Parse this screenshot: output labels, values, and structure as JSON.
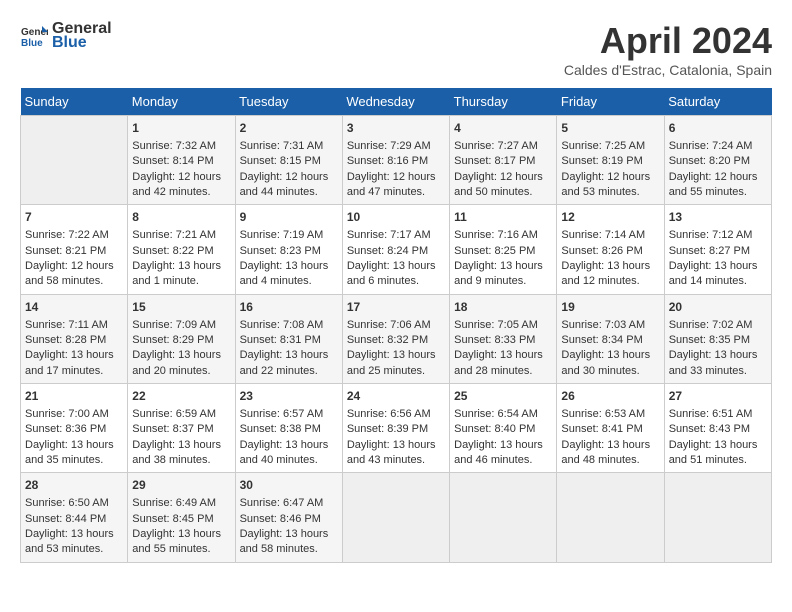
{
  "header": {
    "logo_line1": "General",
    "logo_line2": "Blue",
    "title": "April 2024",
    "subtitle": "Caldes d'Estrac, Catalonia, Spain"
  },
  "weekdays": [
    "Sunday",
    "Monday",
    "Tuesday",
    "Wednesday",
    "Thursday",
    "Friday",
    "Saturday"
  ],
  "weeks": [
    [
      {
        "day": "",
        "content": ""
      },
      {
        "day": "1",
        "content": "Sunrise: 7:32 AM\nSunset: 8:14 PM\nDaylight: 12 hours\nand 42 minutes."
      },
      {
        "day": "2",
        "content": "Sunrise: 7:31 AM\nSunset: 8:15 PM\nDaylight: 12 hours\nand 44 minutes."
      },
      {
        "day": "3",
        "content": "Sunrise: 7:29 AM\nSunset: 8:16 PM\nDaylight: 12 hours\nand 47 minutes."
      },
      {
        "day": "4",
        "content": "Sunrise: 7:27 AM\nSunset: 8:17 PM\nDaylight: 12 hours\nand 50 minutes."
      },
      {
        "day": "5",
        "content": "Sunrise: 7:25 AM\nSunset: 8:19 PM\nDaylight: 12 hours\nand 53 minutes."
      },
      {
        "day": "6",
        "content": "Sunrise: 7:24 AM\nSunset: 8:20 PM\nDaylight: 12 hours\nand 55 minutes."
      }
    ],
    [
      {
        "day": "7",
        "content": "Sunrise: 7:22 AM\nSunset: 8:21 PM\nDaylight: 12 hours\nand 58 minutes."
      },
      {
        "day": "8",
        "content": "Sunrise: 7:21 AM\nSunset: 8:22 PM\nDaylight: 13 hours\nand 1 minute."
      },
      {
        "day": "9",
        "content": "Sunrise: 7:19 AM\nSunset: 8:23 PM\nDaylight: 13 hours\nand 4 minutes."
      },
      {
        "day": "10",
        "content": "Sunrise: 7:17 AM\nSunset: 8:24 PM\nDaylight: 13 hours\nand 6 minutes."
      },
      {
        "day": "11",
        "content": "Sunrise: 7:16 AM\nSunset: 8:25 PM\nDaylight: 13 hours\nand 9 minutes."
      },
      {
        "day": "12",
        "content": "Sunrise: 7:14 AM\nSunset: 8:26 PM\nDaylight: 13 hours\nand 12 minutes."
      },
      {
        "day": "13",
        "content": "Sunrise: 7:12 AM\nSunset: 8:27 PM\nDaylight: 13 hours\nand 14 minutes."
      }
    ],
    [
      {
        "day": "14",
        "content": "Sunrise: 7:11 AM\nSunset: 8:28 PM\nDaylight: 13 hours\nand 17 minutes."
      },
      {
        "day": "15",
        "content": "Sunrise: 7:09 AM\nSunset: 8:29 PM\nDaylight: 13 hours\nand 20 minutes."
      },
      {
        "day": "16",
        "content": "Sunrise: 7:08 AM\nSunset: 8:31 PM\nDaylight: 13 hours\nand 22 minutes."
      },
      {
        "day": "17",
        "content": "Sunrise: 7:06 AM\nSunset: 8:32 PM\nDaylight: 13 hours\nand 25 minutes."
      },
      {
        "day": "18",
        "content": "Sunrise: 7:05 AM\nSunset: 8:33 PM\nDaylight: 13 hours\nand 28 minutes."
      },
      {
        "day": "19",
        "content": "Sunrise: 7:03 AM\nSunset: 8:34 PM\nDaylight: 13 hours\nand 30 minutes."
      },
      {
        "day": "20",
        "content": "Sunrise: 7:02 AM\nSunset: 8:35 PM\nDaylight: 13 hours\nand 33 minutes."
      }
    ],
    [
      {
        "day": "21",
        "content": "Sunrise: 7:00 AM\nSunset: 8:36 PM\nDaylight: 13 hours\nand 35 minutes."
      },
      {
        "day": "22",
        "content": "Sunrise: 6:59 AM\nSunset: 8:37 PM\nDaylight: 13 hours\nand 38 minutes."
      },
      {
        "day": "23",
        "content": "Sunrise: 6:57 AM\nSunset: 8:38 PM\nDaylight: 13 hours\nand 40 minutes."
      },
      {
        "day": "24",
        "content": "Sunrise: 6:56 AM\nSunset: 8:39 PM\nDaylight: 13 hours\nand 43 minutes."
      },
      {
        "day": "25",
        "content": "Sunrise: 6:54 AM\nSunset: 8:40 PM\nDaylight: 13 hours\nand 46 minutes."
      },
      {
        "day": "26",
        "content": "Sunrise: 6:53 AM\nSunset: 8:41 PM\nDaylight: 13 hours\nand 48 minutes."
      },
      {
        "day": "27",
        "content": "Sunrise: 6:51 AM\nSunset: 8:43 PM\nDaylight: 13 hours\nand 51 minutes."
      }
    ],
    [
      {
        "day": "28",
        "content": "Sunrise: 6:50 AM\nSunset: 8:44 PM\nDaylight: 13 hours\nand 53 minutes."
      },
      {
        "day": "29",
        "content": "Sunrise: 6:49 AM\nSunset: 8:45 PM\nDaylight: 13 hours\nand 55 minutes."
      },
      {
        "day": "30",
        "content": "Sunrise: 6:47 AM\nSunset: 8:46 PM\nDaylight: 13 hours\nand 58 minutes."
      },
      {
        "day": "",
        "content": ""
      },
      {
        "day": "",
        "content": ""
      },
      {
        "day": "",
        "content": ""
      },
      {
        "day": "",
        "content": ""
      }
    ]
  ]
}
